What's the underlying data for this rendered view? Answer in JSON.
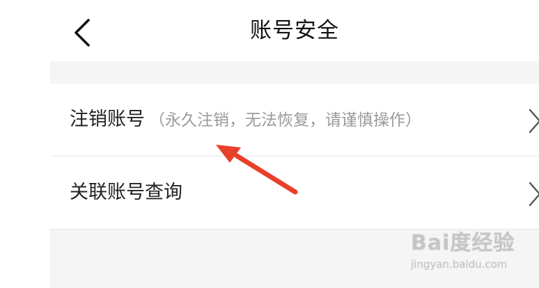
{
  "header": {
    "title": "账号安全",
    "back_icon": "chevron-left-icon"
  },
  "menu": {
    "items": [
      {
        "label": "注销账号",
        "hint": "（永久注销，无法恢复，请谨慎操作）",
        "chevron_icon": "chevron-right-icon"
      },
      {
        "label": "关联账号查询",
        "hint": "",
        "chevron_icon": "chevron-right-icon"
      }
    ]
  },
  "annotation": {
    "arrow_color": "#e8402a",
    "points_to": "menu.items.0"
  },
  "watermark": {
    "logo_text": "Bai度经验",
    "url": "jingyan.baidu.com"
  },
  "colors": {
    "background": "#ffffff",
    "content_background": "#f5f5f5",
    "primary_text": "#222222",
    "hint_text": "#9a9a9a",
    "divider": "#e6e6e6"
  }
}
